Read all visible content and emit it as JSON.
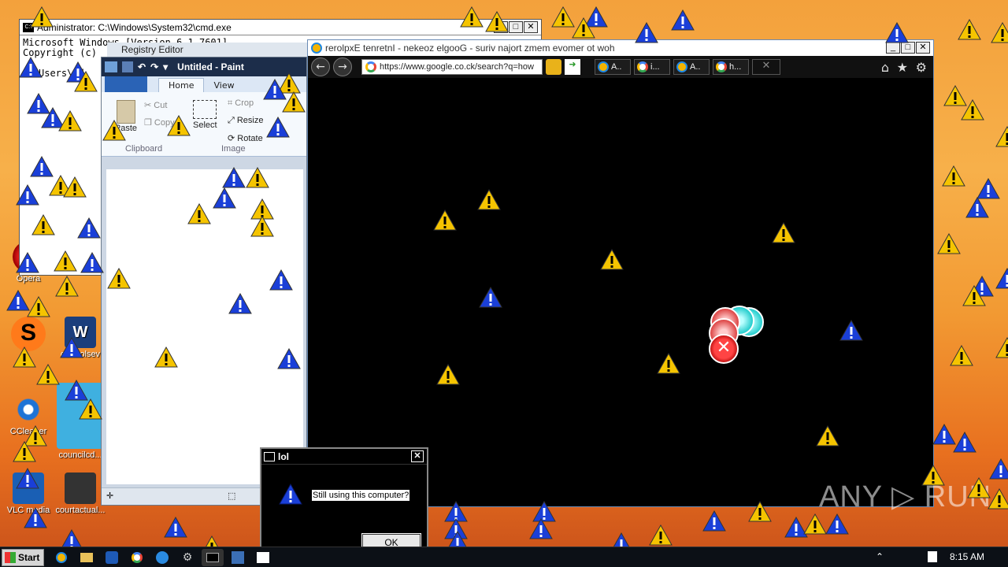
{
  "desktop_icons": [
    {
      "id": "opera",
      "label": "Opera"
    },
    {
      "id": "controlsev",
      "label": "controlsev"
    },
    {
      "id": "courtactual",
      "label": "courtactual..."
    },
    {
      "id": "vlc",
      "label": "VLC media"
    },
    {
      "id": "council",
      "label": "councilcd..."
    },
    {
      "id": "ccleaner",
      "label": "CCleaner"
    }
  ],
  "cmd": {
    "title": "Administrator: C:\\Windows\\System32\\cmd.exe",
    "line1": "Microsoft Windows [Version 6.1.7601]",
    "line2": "Copyright (c)",
    "line3": "Users\\ad"
  },
  "registry": {
    "title": "Registry Editor"
  },
  "paint": {
    "title": "Untitled - Paint",
    "tabs": [
      "Home",
      "View"
    ],
    "clipboard": {
      "paste": "Paste",
      "cut": "Cut",
      "copy": "Copy",
      "group": "Clipboard"
    },
    "image": {
      "select": "Select",
      "crop": "Crop",
      "resize": "Resize",
      "rotate": "Rotate",
      "group": "Image"
    }
  },
  "ie": {
    "title": "rerolpxE tenretnI - nekeoz elgooG - suriv najort zmem evomer ot woh",
    "url": "https://www.google.co.ck/search?q=how",
    "tabs": [
      "A..",
      "i...",
      "A..",
      "h..."
    ]
  },
  "dialog": {
    "title": "lol",
    "message": "Still using this computer?",
    "ok_label": "OK"
  },
  "taskbar": {
    "start_label": "Start",
    "clock": "8:15 AM"
  },
  "watermark": "ANY ▷ RUN",
  "colors": {
    "warning_yellow": "#f5c400",
    "info_blue": "#1a3fd8"
  }
}
